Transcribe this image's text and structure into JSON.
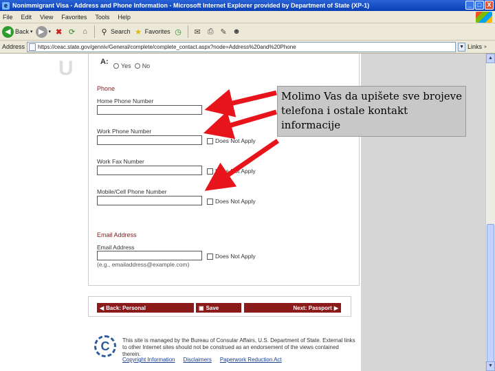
{
  "window": {
    "title": "Nonimmigrant Visa - Address and Phone Information - Microsoft Internet Explorer provided by Department of State (XP-1)",
    "controls": [
      "_",
      "□",
      "X"
    ]
  },
  "menu": [
    "File",
    "Edit",
    "View",
    "Favorites",
    "Tools",
    "Help"
  ],
  "toolbar": {
    "back": "Back",
    "search": "Search",
    "favorites": "Favorites"
  },
  "address": {
    "label": "Address",
    "url": "https://ceac.state.gov/genniv/General/complete/complete_contact.aspx?node=Address%20and%20Phone",
    "links": "Links"
  },
  "form": {
    "question": "A:",
    "radio_yes": "Yes",
    "radio_no": "No",
    "phone_section": "Phone",
    "home_phone_label": "Home Phone Number",
    "work_phone_label": "Work Phone Number",
    "work_fax_label": "Work Fax Number",
    "mobile_label": "Mobile/Cell Phone Number",
    "does_not_apply": "Does Not Apply",
    "email_section": "Email Address",
    "email_label": "Email Address",
    "email_hint": "(e.g., emailaddress@example.com)"
  },
  "nav": {
    "back": "Back: Personal",
    "save": "Save",
    "next": "Next: Passport"
  },
  "footer": {
    "text": "This site is managed by the Bureau of Consular Affairs, U.S. Department of State. External links to other Internet sites should not be construed as an endorsement of the views contained therein.",
    "links": [
      "Copyright Information",
      "Disclaimers",
      "Paperwork Reduction Act"
    ],
    "seal_letter": "C"
  },
  "callout": "Molimo Vas da upišete sve brojeve telefona i ostale kontakt informacije",
  "colors": {
    "nav_button": "#8b1a1a",
    "arrow": "#e8141c"
  }
}
